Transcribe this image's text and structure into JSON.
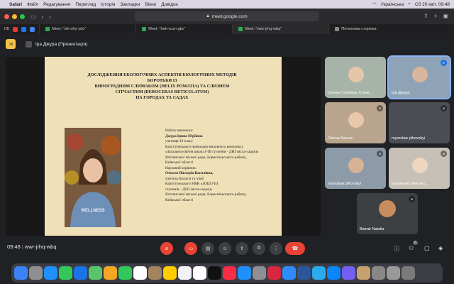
{
  "menubar": {
    "app": "Safari",
    "items": [
      "Файл",
      "Редагування",
      "Перегляд",
      "Історія",
      "Закладки",
      "Вікно",
      "Довідка"
    ],
    "input_source": "Українська",
    "clock": "Сб 20 квіт. 09:48"
  },
  "browser": {
    "url": "meet.google.com",
    "favorites": [
      "HD"
    ],
    "tabs": [
      {
        "label": "Meet: \"xih-ofry-ydv\"",
        "active": false
      },
      {
        "label": "Meet: \"hah-vczn-gkz\"",
        "active": false
      },
      {
        "label": "Meet: \"wwr-jrhq-wbq\"",
        "active": true
      },
      {
        "label": "Початкова сторінка",
        "active": false
      }
    ]
  },
  "meet": {
    "presenter_label": "Іра Джура (Презентація)",
    "meeting_time": "09:48",
    "meeting_code": "wwr-jrhq-wbq",
    "people_count": "6"
  },
  "slide": {
    "title_lines": [
      "ДОСЛІДЖЕННЯ ЕКОЛОГІЧНИХ АСПЕКТІВ БІОЛОГІЧНИХ МЕТОДІВ",
      "БОРОТЬБИ ІЗ",
      "ВИНОГРАДНИМ СЛИМАКОМ (HELIX POMATIA) ТА СЛИЗНЕМ",
      "СІТЧАСТИМ (DEROCERAS RETICULATUM)",
      "НА ГОРОДАХ ТА САДАХ"
    ],
    "info_lines": [
      "Роботу виконала:",
      "Джура Ірина Юріївна",
      "учениця 10 класу",
      "Капустинського навчально-виховного комплексу «Загальноосвітня школа І-ІІІ ступенів - ДНЗ (ясла-садок)»",
      "Яготинської міської ради, Бориспільського району,",
      "Київської області",
      "Науковий керівник:",
      "Очкало Вікторія Василівна,",
      "учитель біології та хімії",
      "Капустинського НВК «ЗОШ І-ІІІ",
      "ступенів – ДНЗ (ясла-садок)»",
      "Яготинської міської ради, Бориспільського району,",
      "Київської області"
    ],
    "bold_indices": [
      1,
      7
    ]
  },
  "participants": [
    {
      "name": "Олена Горобець Стапк..."
    },
    {
      "name": "Іра Джура"
    },
    {
      "name": "Олена Баштa"
    },
    {
      "name": "myroslaw pikovskyi"
    },
    {
      "name": "myroslaw pikovskyi"
    },
    {
      "name": "Кузьменко Яна Ал..."
    },
    {
      "name": "Batrak Natalia"
    }
  ],
  "colors": {
    "accent": "#ea4335",
    "meet_bg": "#202124",
    "slide_bg": "#efe0b8",
    "menubar_bg": "#dcd6e3"
  }
}
